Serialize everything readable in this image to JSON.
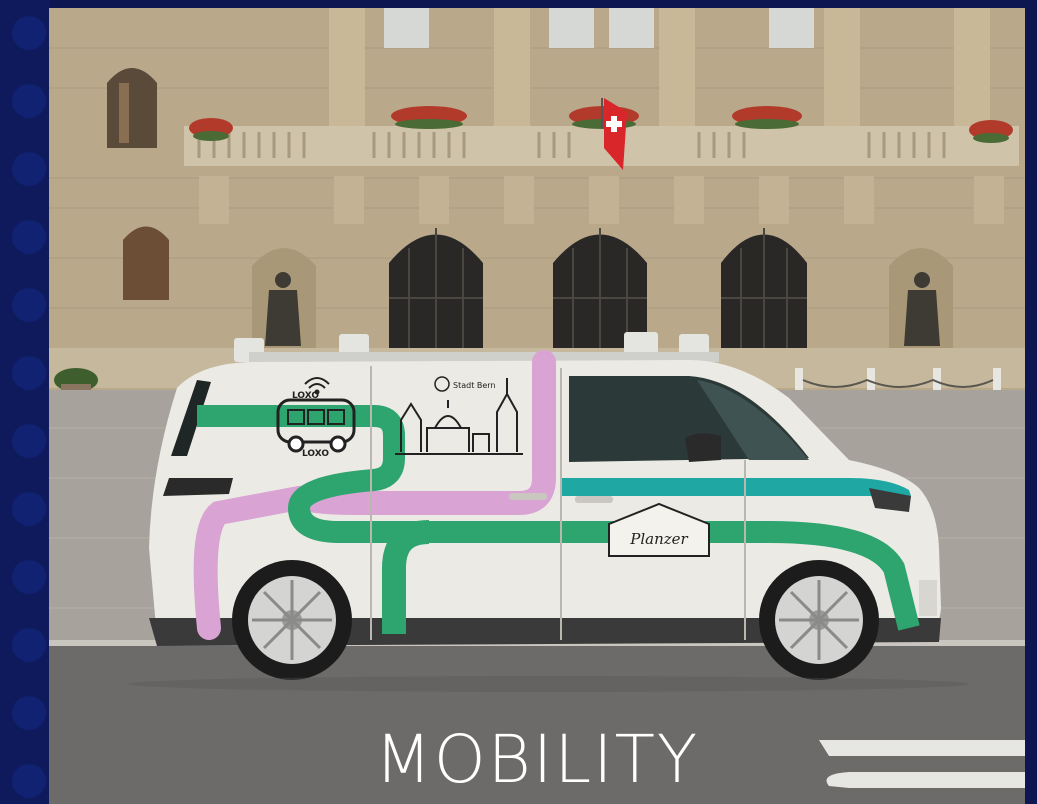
{
  "caption": "MOBILITY",
  "van": {
    "brand_left": "LOXO",
    "brand_bottom": "LOXO",
    "city_label": "Stadt Bern",
    "company_logo": "Planzer"
  },
  "colors": {
    "frame_background": "#0d1650",
    "van_body": "#eceae4",
    "livery_green": "#2ea46f",
    "livery_pink": "#d9a3d4",
    "livery_teal": "#1fa7a3",
    "flag_red": "#d8262b"
  },
  "icons": [
    "wifi-icon",
    "bus-icon",
    "swiss-flag-icon",
    "bear-crest-icon"
  ]
}
